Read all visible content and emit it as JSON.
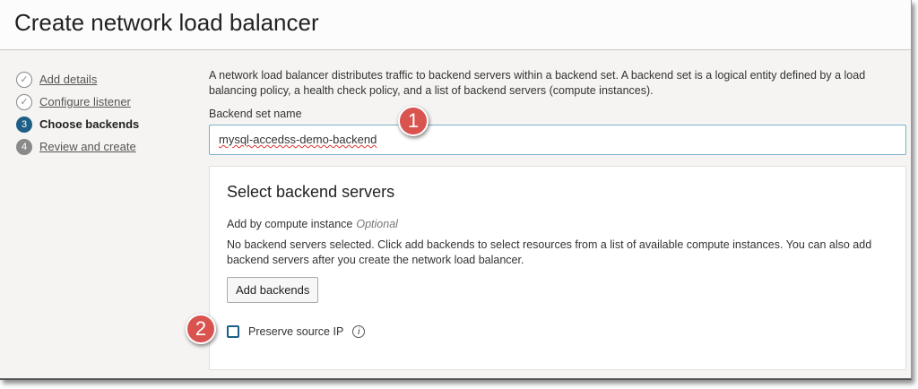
{
  "title": "Create network load balancer",
  "steps": [
    {
      "num": "1",
      "label": "Add details",
      "state": "done"
    },
    {
      "num": "2",
      "label": "Configure listener",
      "state": "done"
    },
    {
      "num": "3",
      "label": "Choose backends",
      "state": "current"
    },
    {
      "num": "4",
      "label": "Review and create",
      "state": "todo"
    }
  ],
  "description": "A network load balancer distributes traffic to backend servers within a backend set. A backend set is a logical entity defined by a load balancing policy, a health check policy, and a list of backend servers (compute instances).",
  "backend_set": {
    "label": "Backend set name",
    "value": "mysql-accedss-demo-backend"
  },
  "card": {
    "title": "Select backend servers",
    "add_by": "Add by compute instance",
    "optional": "Optional",
    "message": "No backend servers selected. Click add backends to select resources from a list of available compute instances. You can also add backend servers after you create the network load balancer.",
    "add_button": "Add backends",
    "preserve_label": "Preserve source IP",
    "preserve_checked": false,
    "info": "i"
  },
  "callouts": [
    "1",
    "2"
  ]
}
